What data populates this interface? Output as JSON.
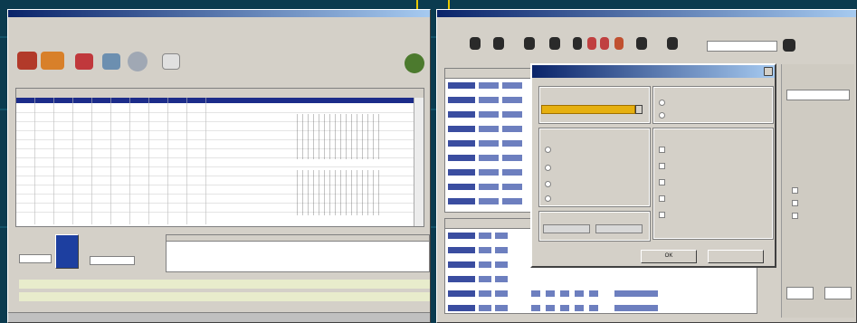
{
  "left_window": {
    "title": "",
    "menu": [
      "",
      "",
      "",
      "",
      ""
    ],
    "shortcuts": [
      "",
      "",
      ""
    ],
    "bottom_fields": [
      "",
      ""
    ],
    "center_button_label": "",
    "status": ""
  },
  "right_window": {
    "title": "",
    "search_value": "",
    "side_field_value": ""
  },
  "dialog": {
    "title": "",
    "dropdown_value": "",
    "ok_label": "OK",
    "cancel_label": ""
  }
}
